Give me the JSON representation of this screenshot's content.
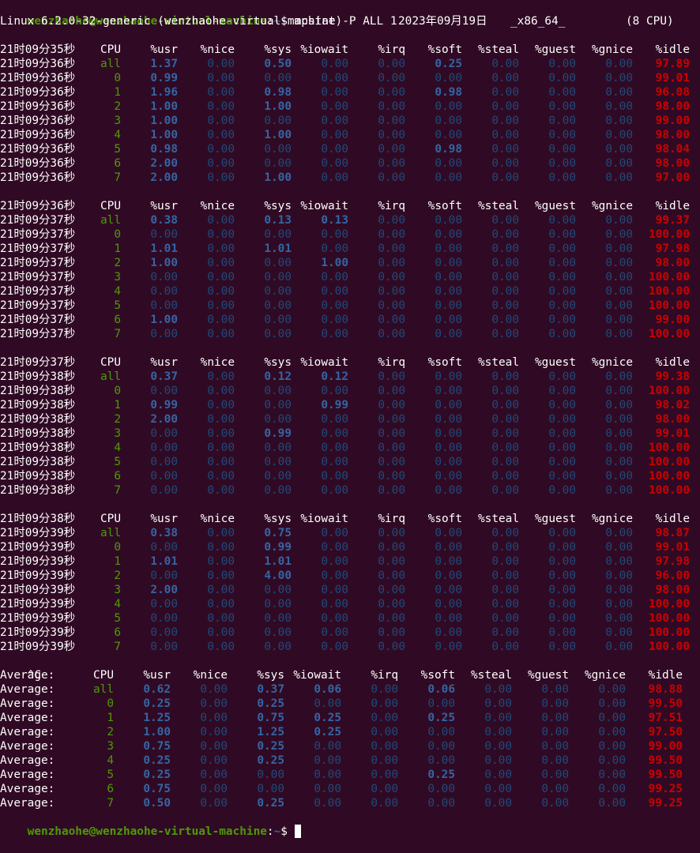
{
  "terminal": {
    "prompt_user": "wenzhaohe@wenzhaohe-virtual-machine",
    "prompt_path": "~",
    "prompt_symbol": "$",
    "command": "mpstat -P ALL 1",
    "sysinfo": {
      "kernel": "Linux 6.2.0-32-generic (wenzhaohe-virtual-machine)",
      "date": "2023年09月19日",
      "arch": "_x86_64_",
      "cpus": "(8 CPU)"
    },
    "interrupt": "^C"
  },
  "colors": {
    "background": "#300a24",
    "prompt_user": "#4e9a06",
    "prompt_path": "#3465a4",
    "cpu_id": "#4e9a06",
    "value_highlight": "#3465a4",
    "value_zero": "#1f4a7a",
    "idle": "#cc0000",
    "text": "#ffffff"
  },
  "columns": [
    "CPU",
    "%usr",
    "%nice",
    "%sys",
    "%iowait",
    "%irq",
    "%soft",
    "%steal",
    "%guest",
    "%gnice",
    "%idle"
  ],
  "blocks": [
    {
      "header_time": "21时09分35秒",
      "rows": [
        {
          "time": "21时09分36秒",
          "cpu": "all",
          "usr": "1.37",
          "nice": "0.00",
          "sys": "0.50",
          "iowait": "0.00",
          "irq": "0.00",
          "soft": "0.25",
          "steal": "0.00",
          "guest": "0.00",
          "gnice": "0.00",
          "idle": "97.89"
        },
        {
          "time": "21时09分36秒",
          "cpu": "0",
          "usr": "0.99",
          "nice": "0.00",
          "sys": "0.00",
          "iowait": "0.00",
          "irq": "0.00",
          "soft": "0.00",
          "steal": "0.00",
          "guest": "0.00",
          "gnice": "0.00",
          "idle": "99.01"
        },
        {
          "time": "21时09分36秒",
          "cpu": "1",
          "usr": "1.96",
          "nice": "0.00",
          "sys": "0.98",
          "iowait": "0.00",
          "irq": "0.00",
          "soft": "0.98",
          "steal": "0.00",
          "guest": "0.00",
          "gnice": "0.00",
          "idle": "96.08"
        },
        {
          "time": "21时09分36秒",
          "cpu": "2",
          "usr": "1.00",
          "nice": "0.00",
          "sys": "1.00",
          "iowait": "0.00",
          "irq": "0.00",
          "soft": "0.00",
          "steal": "0.00",
          "guest": "0.00",
          "gnice": "0.00",
          "idle": "98.00"
        },
        {
          "time": "21时09分36秒",
          "cpu": "3",
          "usr": "1.00",
          "nice": "0.00",
          "sys": "0.00",
          "iowait": "0.00",
          "irq": "0.00",
          "soft": "0.00",
          "steal": "0.00",
          "guest": "0.00",
          "gnice": "0.00",
          "idle": "99.00"
        },
        {
          "time": "21时09分36秒",
          "cpu": "4",
          "usr": "1.00",
          "nice": "0.00",
          "sys": "1.00",
          "iowait": "0.00",
          "irq": "0.00",
          "soft": "0.00",
          "steal": "0.00",
          "guest": "0.00",
          "gnice": "0.00",
          "idle": "98.00"
        },
        {
          "time": "21时09分36秒",
          "cpu": "5",
          "usr": "0.98",
          "nice": "0.00",
          "sys": "0.00",
          "iowait": "0.00",
          "irq": "0.00",
          "soft": "0.98",
          "steal": "0.00",
          "guest": "0.00",
          "gnice": "0.00",
          "idle": "98.04"
        },
        {
          "time": "21时09分36秒",
          "cpu": "6",
          "usr": "2.00",
          "nice": "0.00",
          "sys": "0.00",
          "iowait": "0.00",
          "irq": "0.00",
          "soft": "0.00",
          "steal": "0.00",
          "guest": "0.00",
          "gnice": "0.00",
          "idle": "98.00"
        },
        {
          "time": "21时09分36秒",
          "cpu": "7",
          "usr": "2.00",
          "nice": "0.00",
          "sys": "1.00",
          "iowait": "0.00",
          "irq": "0.00",
          "soft": "0.00",
          "steal": "0.00",
          "guest": "0.00",
          "gnice": "0.00",
          "idle": "97.00"
        }
      ]
    },
    {
      "header_time": "21时09分36秒",
      "rows": [
        {
          "time": "21时09分37秒",
          "cpu": "all",
          "usr": "0.38",
          "nice": "0.00",
          "sys": "0.13",
          "iowait": "0.13",
          "irq": "0.00",
          "soft": "0.00",
          "steal": "0.00",
          "guest": "0.00",
          "gnice": "0.00",
          "idle": "99.37"
        },
        {
          "time": "21时09分37秒",
          "cpu": "0",
          "usr": "0.00",
          "nice": "0.00",
          "sys": "0.00",
          "iowait": "0.00",
          "irq": "0.00",
          "soft": "0.00",
          "steal": "0.00",
          "guest": "0.00",
          "gnice": "0.00",
          "idle": "100.00"
        },
        {
          "time": "21时09分37秒",
          "cpu": "1",
          "usr": "1.01",
          "nice": "0.00",
          "sys": "1.01",
          "iowait": "0.00",
          "irq": "0.00",
          "soft": "0.00",
          "steal": "0.00",
          "guest": "0.00",
          "gnice": "0.00",
          "idle": "97.98"
        },
        {
          "time": "21时09分37秒",
          "cpu": "2",
          "usr": "1.00",
          "nice": "0.00",
          "sys": "0.00",
          "iowait": "1.00",
          "irq": "0.00",
          "soft": "0.00",
          "steal": "0.00",
          "guest": "0.00",
          "gnice": "0.00",
          "idle": "98.00"
        },
        {
          "time": "21时09分37秒",
          "cpu": "3",
          "usr": "0.00",
          "nice": "0.00",
          "sys": "0.00",
          "iowait": "0.00",
          "irq": "0.00",
          "soft": "0.00",
          "steal": "0.00",
          "guest": "0.00",
          "gnice": "0.00",
          "idle": "100.00"
        },
        {
          "time": "21时09分37秒",
          "cpu": "4",
          "usr": "0.00",
          "nice": "0.00",
          "sys": "0.00",
          "iowait": "0.00",
          "irq": "0.00",
          "soft": "0.00",
          "steal": "0.00",
          "guest": "0.00",
          "gnice": "0.00",
          "idle": "100.00"
        },
        {
          "time": "21时09分37秒",
          "cpu": "5",
          "usr": "0.00",
          "nice": "0.00",
          "sys": "0.00",
          "iowait": "0.00",
          "irq": "0.00",
          "soft": "0.00",
          "steal": "0.00",
          "guest": "0.00",
          "gnice": "0.00",
          "idle": "100.00"
        },
        {
          "time": "21时09分37秒",
          "cpu": "6",
          "usr": "1.00",
          "nice": "0.00",
          "sys": "0.00",
          "iowait": "0.00",
          "irq": "0.00",
          "soft": "0.00",
          "steal": "0.00",
          "guest": "0.00",
          "gnice": "0.00",
          "idle": "99.00"
        },
        {
          "time": "21时09分37秒",
          "cpu": "7",
          "usr": "0.00",
          "nice": "0.00",
          "sys": "0.00",
          "iowait": "0.00",
          "irq": "0.00",
          "soft": "0.00",
          "steal": "0.00",
          "guest": "0.00",
          "gnice": "0.00",
          "idle": "100.00"
        }
      ]
    },
    {
      "header_time": "21时09分37秒",
      "rows": [
        {
          "time": "21时09分38秒",
          "cpu": "all",
          "usr": "0.37",
          "nice": "0.00",
          "sys": "0.12",
          "iowait": "0.12",
          "irq": "0.00",
          "soft": "0.00",
          "steal": "0.00",
          "guest": "0.00",
          "gnice": "0.00",
          "idle": "99.38"
        },
        {
          "time": "21时09分38秒",
          "cpu": "0",
          "usr": "0.00",
          "nice": "0.00",
          "sys": "0.00",
          "iowait": "0.00",
          "irq": "0.00",
          "soft": "0.00",
          "steal": "0.00",
          "guest": "0.00",
          "gnice": "0.00",
          "idle": "100.00"
        },
        {
          "time": "21时09分38秒",
          "cpu": "1",
          "usr": "0.99",
          "nice": "0.00",
          "sys": "0.00",
          "iowait": "0.99",
          "irq": "0.00",
          "soft": "0.00",
          "steal": "0.00",
          "guest": "0.00",
          "gnice": "0.00",
          "idle": "98.02"
        },
        {
          "time": "21时09分38秒",
          "cpu": "2",
          "usr": "2.00",
          "nice": "0.00",
          "sys": "0.00",
          "iowait": "0.00",
          "irq": "0.00",
          "soft": "0.00",
          "steal": "0.00",
          "guest": "0.00",
          "gnice": "0.00",
          "idle": "98.00"
        },
        {
          "time": "21时09分38秒",
          "cpu": "3",
          "usr": "0.00",
          "nice": "0.00",
          "sys": "0.99",
          "iowait": "0.00",
          "irq": "0.00",
          "soft": "0.00",
          "steal": "0.00",
          "guest": "0.00",
          "gnice": "0.00",
          "idle": "99.01"
        },
        {
          "time": "21时09分38秒",
          "cpu": "4",
          "usr": "0.00",
          "nice": "0.00",
          "sys": "0.00",
          "iowait": "0.00",
          "irq": "0.00",
          "soft": "0.00",
          "steal": "0.00",
          "guest": "0.00",
          "gnice": "0.00",
          "idle": "100.00"
        },
        {
          "time": "21时09分38秒",
          "cpu": "5",
          "usr": "0.00",
          "nice": "0.00",
          "sys": "0.00",
          "iowait": "0.00",
          "irq": "0.00",
          "soft": "0.00",
          "steal": "0.00",
          "guest": "0.00",
          "gnice": "0.00",
          "idle": "100.00"
        },
        {
          "time": "21时09分38秒",
          "cpu": "6",
          "usr": "0.00",
          "nice": "0.00",
          "sys": "0.00",
          "iowait": "0.00",
          "irq": "0.00",
          "soft": "0.00",
          "steal": "0.00",
          "guest": "0.00",
          "gnice": "0.00",
          "idle": "100.00"
        },
        {
          "time": "21时09分38秒",
          "cpu": "7",
          "usr": "0.00",
          "nice": "0.00",
          "sys": "0.00",
          "iowait": "0.00",
          "irq": "0.00",
          "soft": "0.00",
          "steal": "0.00",
          "guest": "0.00",
          "gnice": "0.00",
          "idle": "100.00"
        }
      ]
    },
    {
      "header_time": "21时09分38秒",
      "rows": [
        {
          "time": "21时09分39秒",
          "cpu": "all",
          "usr": "0.38",
          "nice": "0.00",
          "sys": "0.75",
          "iowait": "0.00",
          "irq": "0.00",
          "soft": "0.00",
          "steal": "0.00",
          "guest": "0.00",
          "gnice": "0.00",
          "idle": "98.87"
        },
        {
          "time": "21时09分39秒",
          "cpu": "0",
          "usr": "0.00",
          "nice": "0.00",
          "sys": "0.99",
          "iowait": "0.00",
          "irq": "0.00",
          "soft": "0.00",
          "steal": "0.00",
          "guest": "0.00",
          "gnice": "0.00",
          "idle": "99.01"
        },
        {
          "time": "21时09分39秒",
          "cpu": "1",
          "usr": "1.01",
          "nice": "0.00",
          "sys": "1.01",
          "iowait": "0.00",
          "irq": "0.00",
          "soft": "0.00",
          "steal": "0.00",
          "guest": "0.00",
          "gnice": "0.00",
          "idle": "97.98"
        },
        {
          "time": "21时09分39秒",
          "cpu": "2",
          "usr": "0.00",
          "nice": "0.00",
          "sys": "4.00",
          "iowait": "0.00",
          "irq": "0.00",
          "soft": "0.00",
          "steal": "0.00",
          "guest": "0.00",
          "gnice": "0.00",
          "idle": "96.00"
        },
        {
          "time": "21时09分39秒",
          "cpu": "3",
          "usr": "2.00",
          "nice": "0.00",
          "sys": "0.00",
          "iowait": "0.00",
          "irq": "0.00",
          "soft": "0.00",
          "steal": "0.00",
          "guest": "0.00",
          "gnice": "0.00",
          "idle": "98.00"
        },
        {
          "time": "21时09分39秒",
          "cpu": "4",
          "usr": "0.00",
          "nice": "0.00",
          "sys": "0.00",
          "iowait": "0.00",
          "irq": "0.00",
          "soft": "0.00",
          "steal": "0.00",
          "guest": "0.00",
          "gnice": "0.00",
          "idle": "100.00"
        },
        {
          "time": "21时09分39秒",
          "cpu": "5",
          "usr": "0.00",
          "nice": "0.00",
          "sys": "0.00",
          "iowait": "0.00",
          "irq": "0.00",
          "soft": "0.00",
          "steal": "0.00",
          "guest": "0.00",
          "gnice": "0.00",
          "idle": "100.00"
        },
        {
          "time": "21时09分39秒",
          "cpu": "6",
          "usr": "0.00",
          "nice": "0.00",
          "sys": "0.00",
          "iowait": "0.00",
          "irq": "0.00",
          "soft": "0.00",
          "steal": "0.00",
          "guest": "0.00",
          "gnice": "0.00",
          "idle": "100.00"
        },
        {
          "time": "21时09分39秒",
          "cpu": "7",
          "usr": "0.00",
          "nice": "0.00",
          "sys": "0.00",
          "iowait": "0.00",
          "irq": "0.00",
          "soft": "0.00",
          "steal": "0.00",
          "guest": "0.00",
          "gnice": "0.00",
          "idle": "100.00"
        }
      ]
    }
  ],
  "average": {
    "label": "Average:",
    "rows": [
      {
        "cpu": "all",
        "usr": "0.62",
        "nice": "0.00",
        "sys": "0.37",
        "iowait": "0.06",
        "irq": "0.00",
        "soft": "0.06",
        "steal": "0.00",
        "guest": "0.00",
        "gnice": "0.00",
        "idle": "98.88"
      },
      {
        "cpu": "0",
        "usr": "0.25",
        "nice": "0.00",
        "sys": "0.25",
        "iowait": "0.00",
        "irq": "0.00",
        "soft": "0.00",
        "steal": "0.00",
        "guest": "0.00",
        "gnice": "0.00",
        "idle": "99.50"
      },
      {
        "cpu": "1",
        "usr": "1.25",
        "nice": "0.00",
        "sys": "0.75",
        "iowait": "0.25",
        "irq": "0.00",
        "soft": "0.25",
        "steal": "0.00",
        "guest": "0.00",
        "gnice": "0.00",
        "idle": "97.51"
      },
      {
        "cpu": "2",
        "usr": "1.00",
        "nice": "0.00",
        "sys": "1.25",
        "iowait": "0.25",
        "irq": "0.00",
        "soft": "0.00",
        "steal": "0.00",
        "guest": "0.00",
        "gnice": "0.00",
        "idle": "97.50"
      },
      {
        "cpu": "3",
        "usr": "0.75",
        "nice": "0.00",
        "sys": "0.25",
        "iowait": "0.00",
        "irq": "0.00",
        "soft": "0.00",
        "steal": "0.00",
        "guest": "0.00",
        "gnice": "0.00",
        "idle": "99.00"
      },
      {
        "cpu": "4",
        "usr": "0.25",
        "nice": "0.00",
        "sys": "0.25",
        "iowait": "0.00",
        "irq": "0.00",
        "soft": "0.00",
        "steal": "0.00",
        "guest": "0.00",
        "gnice": "0.00",
        "idle": "99.50"
      },
      {
        "cpu": "5",
        "usr": "0.25",
        "nice": "0.00",
        "sys": "0.00",
        "iowait": "0.00",
        "irq": "0.00",
        "soft": "0.25",
        "steal": "0.00",
        "guest": "0.00",
        "gnice": "0.00",
        "idle": "99.50"
      },
      {
        "cpu": "6",
        "usr": "0.75",
        "nice": "0.00",
        "sys": "0.00",
        "iowait": "0.00",
        "irq": "0.00",
        "soft": "0.00",
        "steal": "0.00",
        "guest": "0.00",
        "gnice": "0.00",
        "idle": "99.25"
      },
      {
        "cpu": "7",
        "usr": "0.50",
        "nice": "0.00",
        "sys": "0.25",
        "iowait": "0.00",
        "irq": "0.00",
        "soft": "0.00",
        "steal": "0.00",
        "guest": "0.00",
        "gnice": "0.00",
        "idle": "99.25"
      }
    ]
  }
}
